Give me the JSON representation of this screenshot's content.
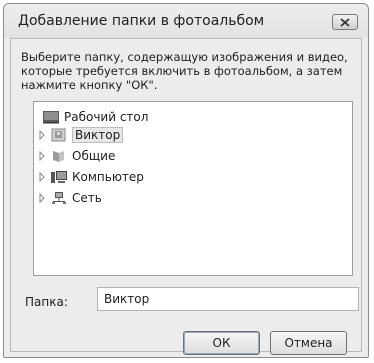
{
  "dialog": {
    "title": "Добавление папки в фотоальбом",
    "instruction": "Выберите папку, содержащую изображения и видео, которые требуется включить в фотоальбом, а затем нажмите кнопку \"ОК\"."
  },
  "tree": {
    "items": [
      {
        "label": "Рабочий стол",
        "icon": "desktop-icon",
        "expander": false,
        "selected": false
      },
      {
        "label": "Виктор",
        "icon": "user-folder-icon",
        "expander": true,
        "selected": true
      },
      {
        "label": "Общие",
        "icon": "shared-folder-icon",
        "expander": true,
        "selected": false
      },
      {
        "label": "Компьютер",
        "icon": "computer-icon",
        "expander": true,
        "selected": false
      },
      {
        "label": "Сеть",
        "icon": "network-icon",
        "expander": true,
        "selected": false
      }
    ]
  },
  "folder": {
    "label": "Папка:",
    "value": "Виктор"
  },
  "buttons": {
    "ok": "ОК",
    "cancel": "Отмена"
  },
  "colors": {
    "window_bg": "#ececec",
    "tree_bg": "#ffffff",
    "selection": "#e8e8e8"
  }
}
